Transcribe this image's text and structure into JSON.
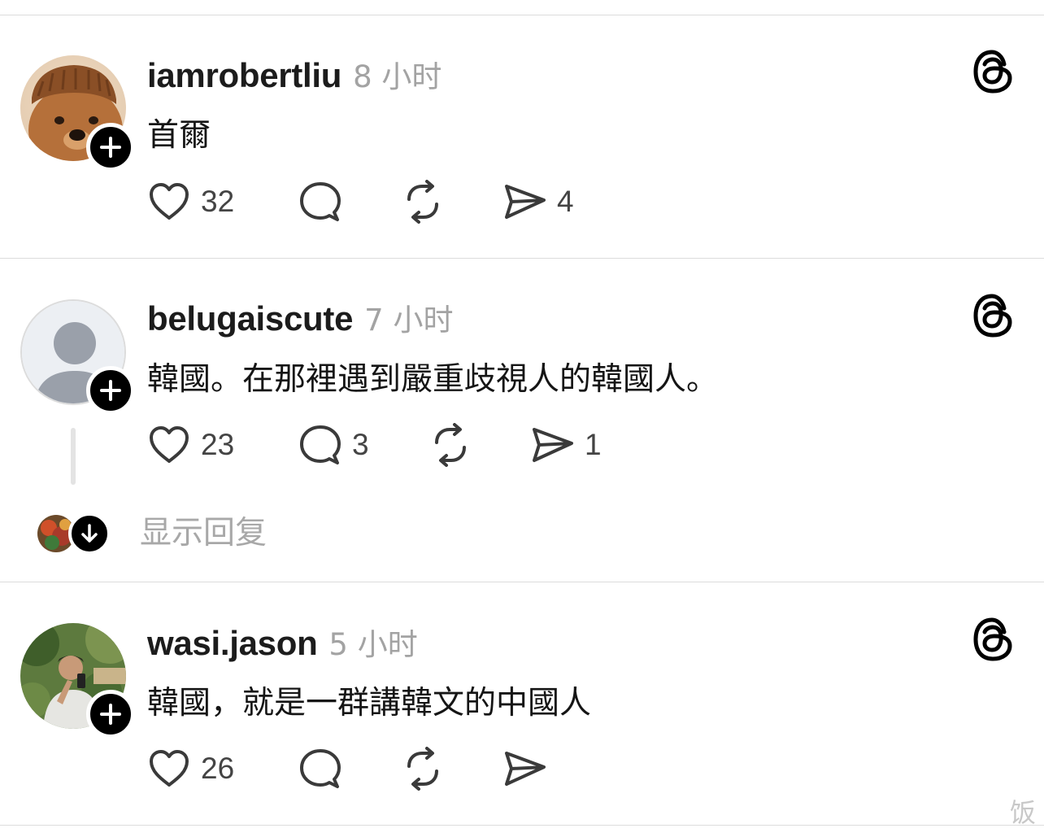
{
  "posts": [
    {
      "username": "iamrobertliu",
      "time": "8 小时",
      "text": "首爾",
      "likes": "32",
      "comments": "",
      "shares": "4",
      "avatar": "dog-with-bangs"
    },
    {
      "username": "belugaiscute",
      "time": "7 小时",
      "text": "韓國。在那裡遇到嚴重歧視人的韓國人。",
      "likes": "23",
      "comments": "3",
      "shares": "1",
      "avatar": "default-person"
    },
    {
      "username": "wasi.jason",
      "time": "5 小时",
      "text": "韓國，就是一群講韓文的中國人",
      "likes": "26",
      "comments": "",
      "shares": "",
      "avatar": "man-taking-selfie"
    }
  ],
  "show_replies_label": "显示回复",
  "watermark": "饭",
  "icons": {
    "follow": "plus-icon",
    "like": "heart-icon",
    "comment": "comment-icon",
    "repost": "repost-icon",
    "share": "share-icon",
    "brand": "threads-icon",
    "expand": "arrow-down-icon"
  },
  "colors": {
    "username": "#1c1c1c",
    "timestamp": "#a3a3a3",
    "divider": "#dcdcdc",
    "icon": "#3a3a3a"
  }
}
